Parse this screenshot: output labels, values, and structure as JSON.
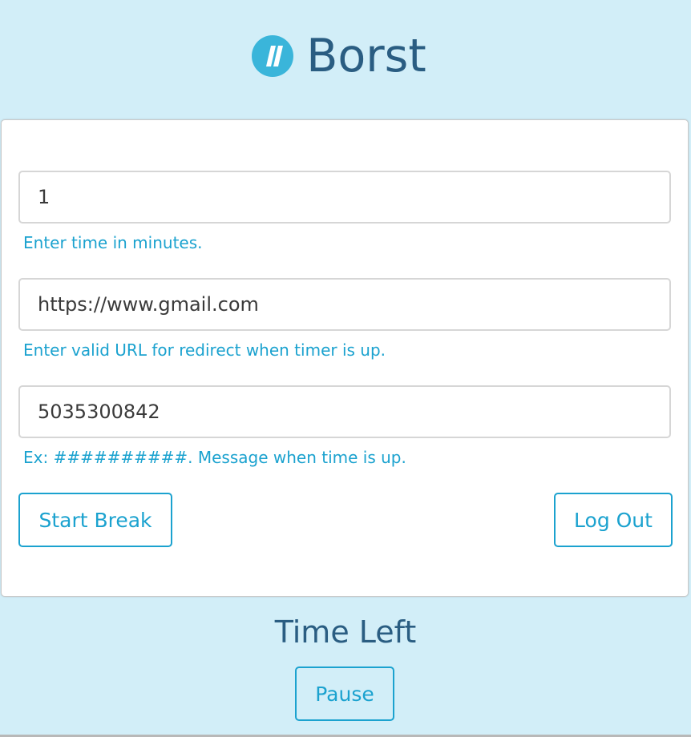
{
  "header": {
    "logo_icon": "pause-circle-icon",
    "title": "Borst"
  },
  "form": {
    "minutes": {
      "value": "1",
      "help": "Enter time in minutes."
    },
    "redirect_url": {
      "value": "https://www.gmail.com",
      "help": "Enter valid URL for redirect when timer is up."
    },
    "phone": {
      "value": "5035300842",
      "help": "Ex: ##########. Message when time is up."
    },
    "start_label": "Start Break",
    "logout_label": "Log Out"
  },
  "timer": {
    "heading": "Time Left",
    "pause_label": "Pause"
  },
  "colors": {
    "background": "#d2eef8",
    "accent": "#1ba2cf",
    "title": "#2a5d82",
    "logo": "#3ab5da"
  }
}
